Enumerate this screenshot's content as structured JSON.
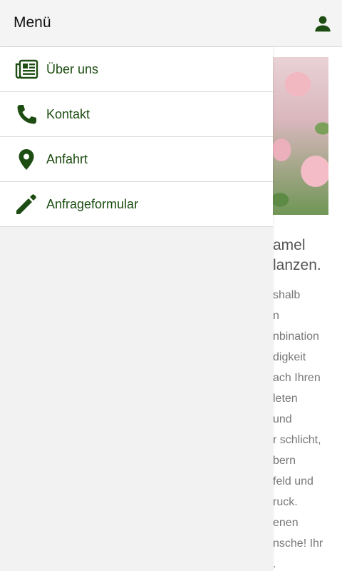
{
  "header": {
    "title": "Menü",
    "user_icon": "user-icon"
  },
  "menu": {
    "items": [
      {
        "label": "Über uns",
        "icon": "newspaper-icon"
      },
      {
        "label": "Kontakt",
        "icon": "phone-icon"
      },
      {
        "label": "Anfahrt",
        "icon": "map-pin-icon"
      },
      {
        "label": "Anfrageformular",
        "icon": "pencil-icon"
      }
    ]
  },
  "background": {
    "title_lines": [
      "amel",
      "lanzen."
    ],
    "text_lines": [
      "shalb",
      "n",
      "nbination",
      "digkeit",
      "ach Ihren",
      "leten",
      "und",
      "r schlicht,",
      "bern",
      "feld und",
      "ruck.",
      "enen",
      "nsche! Ihr",
      "."
    ]
  },
  "colors": {
    "accent": "#1d4d12",
    "header_bg": "#f4f4f4",
    "drawer_bg": "#f2f2f2"
  }
}
